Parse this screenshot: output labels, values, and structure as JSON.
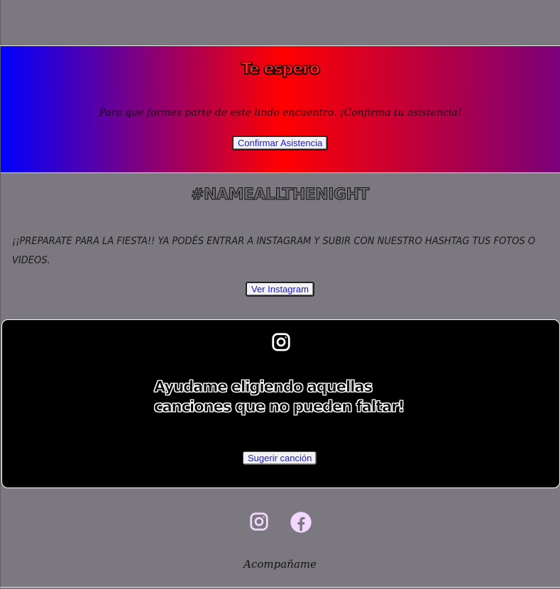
{
  "rsvp": {
    "title": "Te espero",
    "subtitle": "Para que formes parte de este lindo encuentro. ¡Confirma tu asistencia!",
    "button_label": "Confirmar Asistencia"
  },
  "hashtag": {
    "text": "#NAMEALLTHENIGHT",
    "body": "¡¡PREPARATE PARA LA FIESTA!! YA PODÉS ENTRAR A INSTAGRAM Y SUBIR CON NUESTRO HASHTAG TUS FOTOS O VIDEOS.",
    "button_label": "Ver Instagram"
  },
  "songs": {
    "icon": "instagram-icon",
    "headline": "Ayudame eligiendo aquellas canciones que no pueden faltar!",
    "button_label": "Sugerir canción"
  },
  "socials": {
    "items": [
      {
        "icon": "instagram-icon",
        "color": "#f2d7ff"
      },
      {
        "icon": "facebook-icon",
        "color": "#f2d7ff"
      }
    ]
  },
  "footer": {
    "text": "Acompañame"
  },
  "colors": {
    "background": "#7b797f",
    "gradient_start": "#0000ff",
    "gradient_mid": "#ff0000",
    "gradient_end": "#7a007a",
    "button_text": "#1a1ad8"
  }
}
